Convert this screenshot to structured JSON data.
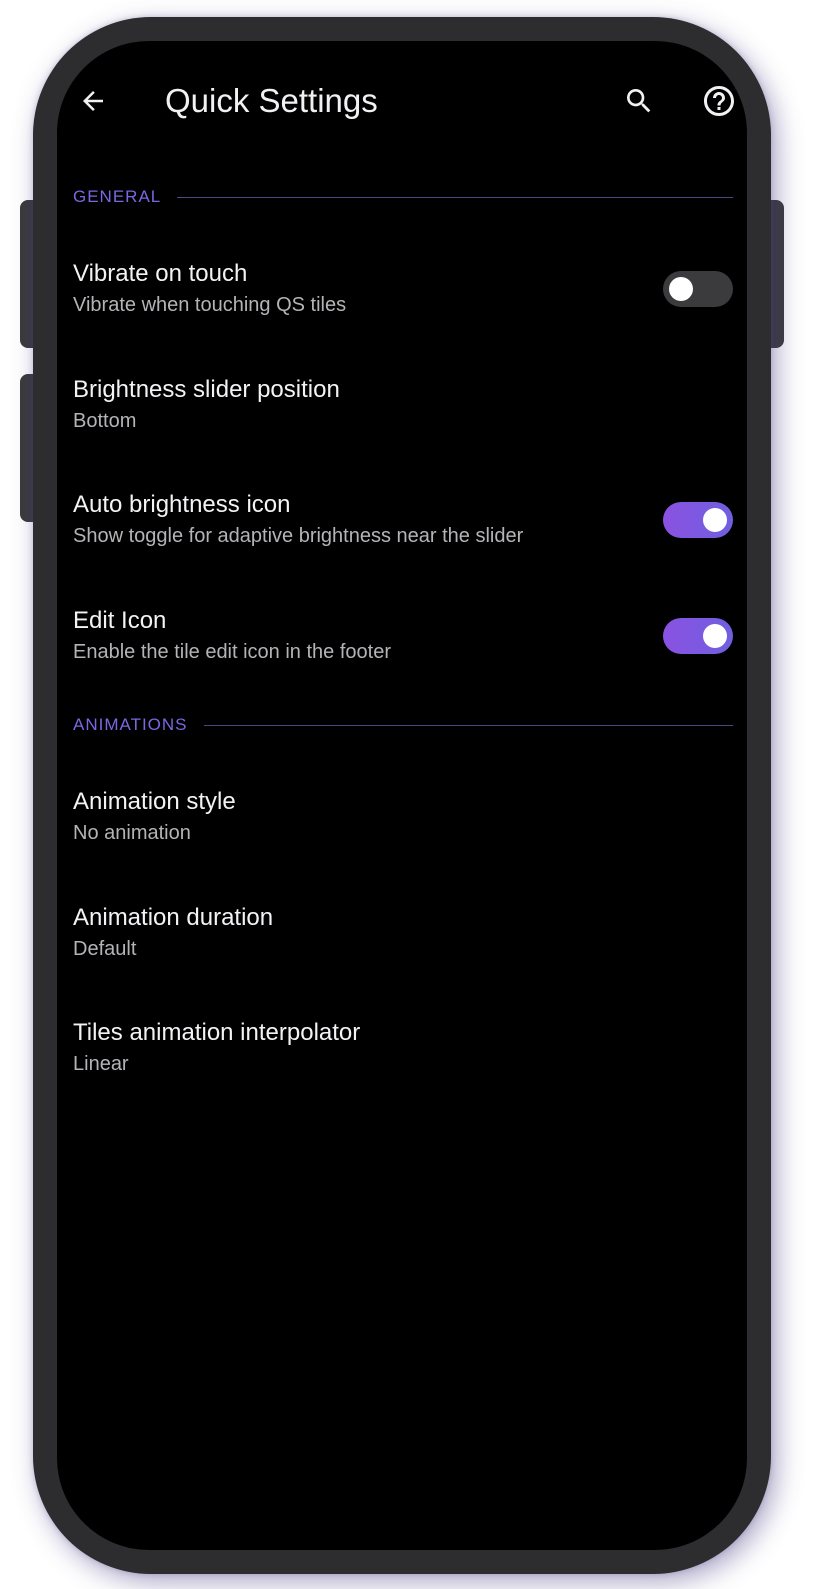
{
  "header": {
    "title": "Quick Settings",
    "back_icon": "arrow-back-icon",
    "search_icon": "search-icon",
    "help_icon": "help-circle-icon"
  },
  "sections": {
    "general": {
      "label": "GENERAL",
      "items": [
        {
          "title": "Vibrate on touch",
          "summary": "Vibrate when touching QS tiles",
          "toggle": false
        },
        {
          "title": "Brightness slider position",
          "summary": "Bottom"
        },
        {
          "title": "Auto brightness icon",
          "summary": "Show toggle for adaptive brightness near the slider",
          "toggle": true
        },
        {
          "title": "Edit Icon",
          "summary": "Enable the tile edit icon in the footer",
          "toggle": true
        }
      ]
    },
    "animations": {
      "label": "ANIMATIONS",
      "items": [
        {
          "title": "Animation style",
          "summary": "No animation"
        },
        {
          "title": "Animation duration",
          "summary": "Default"
        },
        {
          "title": "Tiles animation interpolator",
          "summary": "Linear"
        }
      ]
    }
  },
  "colors": {
    "accent": "#7a68e0",
    "switch_on": "#7b5ae0",
    "switch_off": "#3b3b3e",
    "background": "#000000"
  }
}
